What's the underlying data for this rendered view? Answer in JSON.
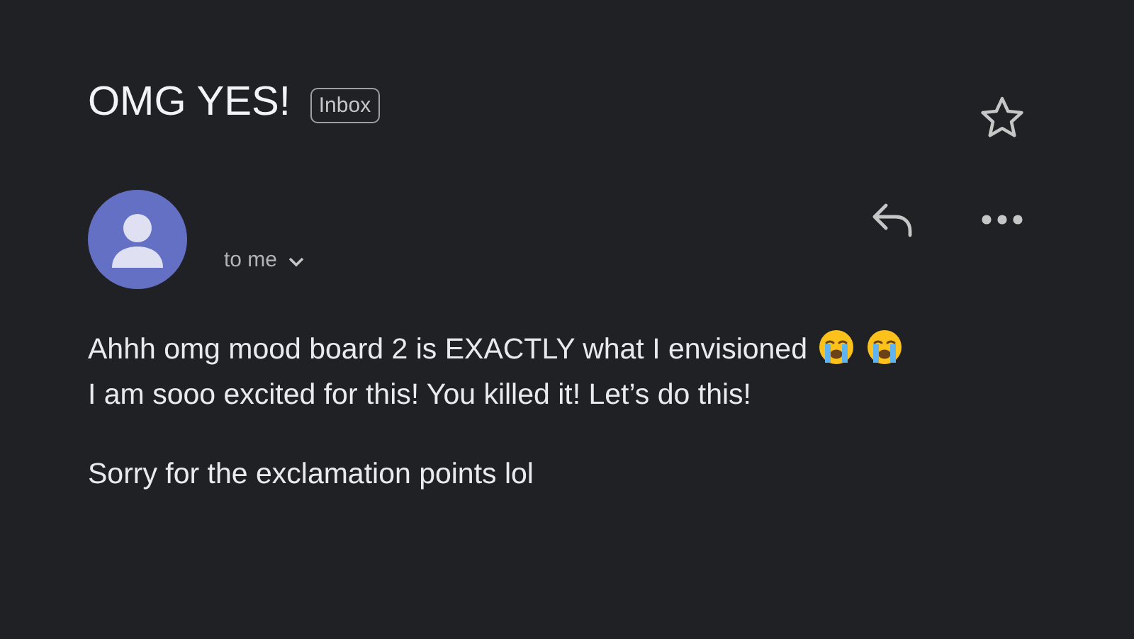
{
  "message": {
    "subject": "OMG YES!",
    "label": "Inbox",
    "starred": false,
    "recipient": "to me",
    "paragraphs": [
      {
        "lines": [
          [
            {
              "kind": "text",
              "text": "Ahhh omg mood board 2 is EXACTLY what I envisioned"
            },
            {
              "kind": "emoji"
            },
            {
              "kind": "emoji"
            }
          ],
          [
            {
              "kind": "text",
              "text": "I am sooo excited for this! You killed it! Let’s do this!"
            }
          ]
        ]
      },
      {
        "lines": [
          [
            {
              "kind": "text",
              "text": "Sorry for the exclamation points lol"
            }
          ]
        ]
      }
    ]
  }
}
